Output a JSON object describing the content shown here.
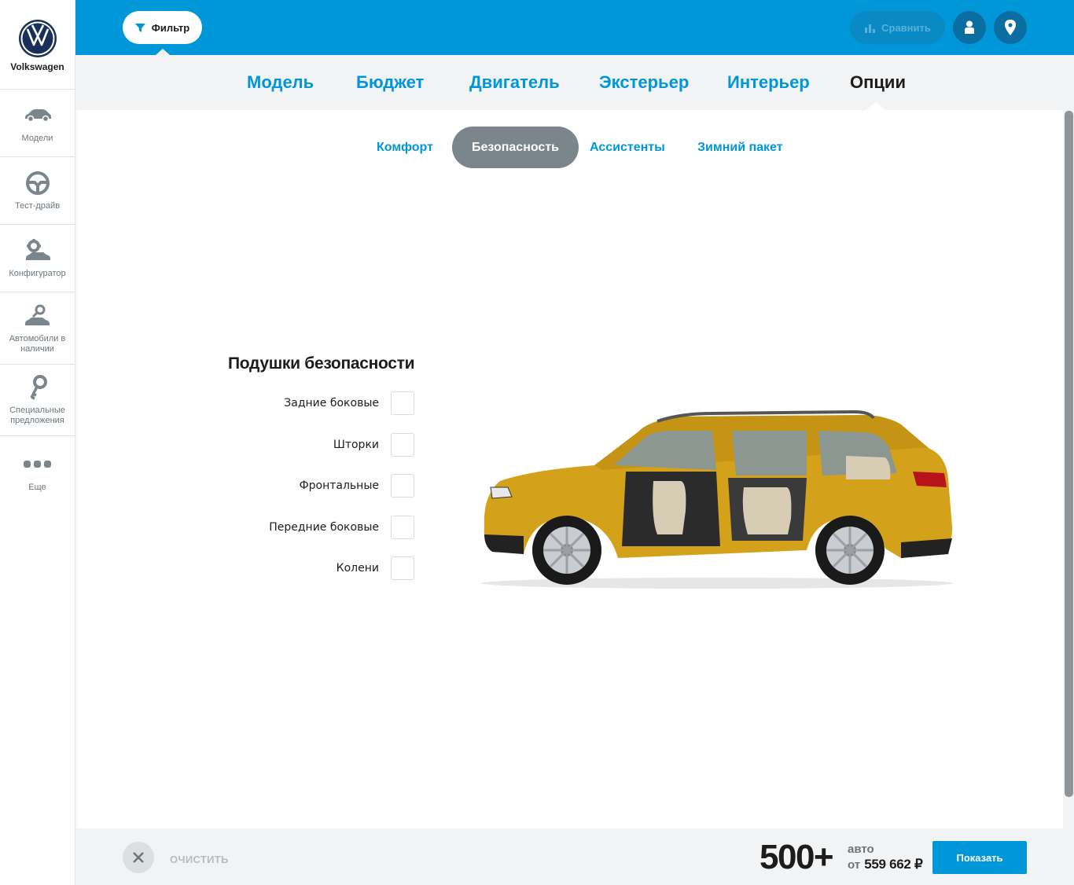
{
  "brand": {
    "name": "Volkswagen",
    "logo": "vw-logo"
  },
  "sidebar": {
    "items": [
      {
        "label": "Модели",
        "icon": "car-icon"
      },
      {
        "label": "Тест-драйв",
        "icon": "steering-wheel-icon"
      },
      {
        "label": "Конфигуратор",
        "icon": "configurator-icon"
      },
      {
        "label": "Автомобили в наличии",
        "icon": "car-search-icon"
      },
      {
        "label": "Специальные предложения",
        "icon": "key-icon"
      },
      {
        "label": "Еще",
        "icon": "more-dots-icon"
      }
    ]
  },
  "topbar": {
    "filter_label": "Фильтр",
    "compare_label": "Сравнить"
  },
  "main_tabs": [
    "Модель",
    "Бюджет",
    "Двигатель",
    "Экстерьер",
    "Интерьер",
    "Опции"
  ],
  "active_main_tab": "Опции",
  "sub_tabs": [
    "Комфорт",
    "Безопасность",
    "Ассистенты",
    "Зимний пакет"
  ],
  "active_sub_tab": "Безопасность",
  "options": {
    "title": "Подушки безопасности",
    "items": [
      {
        "label": "Задние боковые",
        "checked": false
      },
      {
        "label": "Шторки",
        "checked": false
      },
      {
        "label": "Фронтальные",
        "checked": false
      },
      {
        "label": "Передние боковые",
        "checked": false
      },
      {
        "label": "Колени",
        "checked": false
      }
    ]
  },
  "bottom": {
    "clear_label": "ОЧИСТИТЬ",
    "count": "500+",
    "count_unit": "авто",
    "price_prefix": "от",
    "price": "559 662 ₽",
    "show_label": "Показать"
  },
  "colors": {
    "accent": "#0097d8",
    "car_body": "#d4a21a"
  }
}
